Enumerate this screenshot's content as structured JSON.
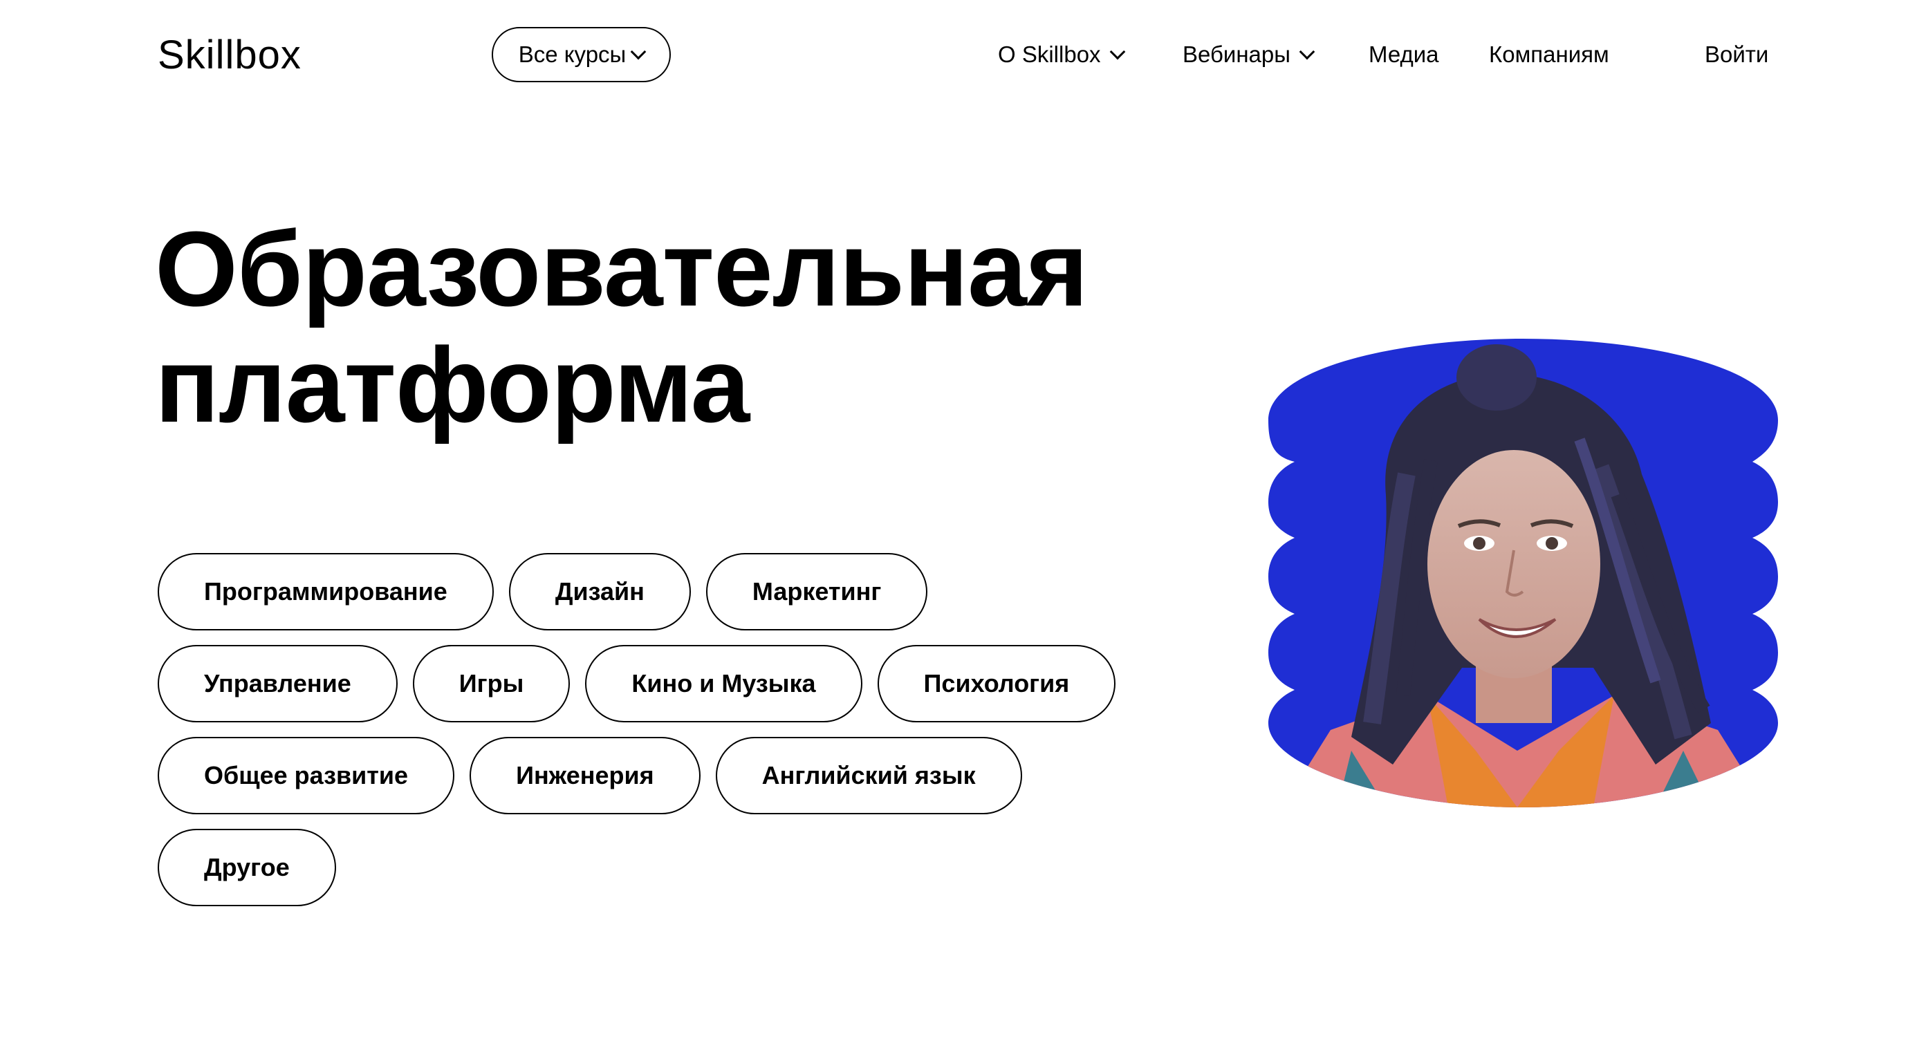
{
  "header": {
    "logo": "Skillbox",
    "all_courses_label": "Все курсы",
    "nav": [
      {
        "label": "О Skillbox"
      },
      {
        "label": "Вебинары"
      },
      {
        "label": "Медиа"
      },
      {
        "label": "Компаниям"
      },
      {
        "label": "Войти"
      }
    ]
  },
  "hero": {
    "title_line1": "Образовательная",
    "title_line2": "платформа"
  },
  "categories": [
    "Программирование",
    "Дизайн",
    "Маркетинг",
    "Управление",
    "Игры",
    "Кино и Музыка",
    "Психология",
    "Общее развитие",
    "Инженерия",
    "Английский язык",
    "Другое"
  ],
  "colors": {
    "text": "#000000",
    "background": "#ffffff",
    "portrait_background": "#1f2ed4"
  }
}
